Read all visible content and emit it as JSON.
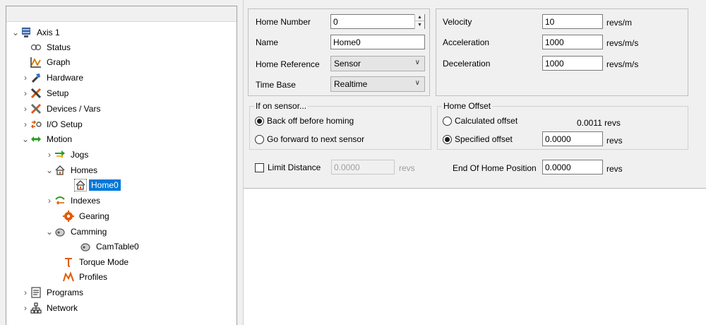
{
  "tree": {
    "items": [
      {
        "label": "Axis 1",
        "toggle": "expanded",
        "icon": "axis-icon"
      },
      {
        "label": "Status",
        "toggle": "none",
        "icon": "status-icon"
      },
      {
        "label": "Graph",
        "toggle": "none",
        "icon": "graph-icon"
      },
      {
        "label": "Hardware",
        "toggle": "collapsed",
        "icon": "hardware-icon"
      },
      {
        "label": "Setup",
        "toggle": "collapsed",
        "icon": "setup-icon"
      },
      {
        "label": "Devices / Vars",
        "toggle": "collapsed",
        "icon": "devices-icon"
      },
      {
        "label": "I/O Setup",
        "toggle": "collapsed",
        "icon": "io-setup-icon"
      },
      {
        "label": "Motion",
        "toggle": "expanded",
        "icon": "motion-icon"
      },
      {
        "label": "Jogs",
        "toggle": "collapsed",
        "icon": "jogs-icon"
      },
      {
        "label": "Homes",
        "toggle": "expanded",
        "icon": "home-icon"
      },
      {
        "label": "Home0",
        "toggle": "none",
        "icon": "home-icon",
        "selected": true
      },
      {
        "label": "Indexes",
        "toggle": "collapsed",
        "icon": "indexes-icon"
      },
      {
        "label": "Gearing",
        "toggle": "none",
        "icon": "gearing-icon"
      },
      {
        "label": "Camming",
        "toggle": "expanded",
        "icon": "camming-icon"
      },
      {
        "label": "CamTable0",
        "toggle": "none",
        "icon": "cam-table-icon"
      },
      {
        "label": "Torque Mode",
        "toggle": "none",
        "icon": "torque-icon"
      },
      {
        "label": "Profiles",
        "toggle": "none",
        "icon": "profiles-icon"
      },
      {
        "label": "Programs",
        "toggle": "collapsed",
        "icon": "programs-icon"
      },
      {
        "label": "Network",
        "toggle": "collapsed",
        "icon": "network-icon"
      }
    ]
  },
  "home": {
    "number_label": "Home Number",
    "number_value": "0",
    "name_label": "Name",
    "name_value": "Home0",
    "reference_label": "Home Reference",
    "reference_value": "Sensor",
    "timebase_label": "Time Base",
    "timebase_value": "Realtime"
  },
  "motion": {
    "velocity_label": "Velocity",
    "velocity_value": "10",
    "velocity_unit": "revs/m",
    "accel_label": "Acceleration",
    "accel_value": "1000",
    "accel_unit": "revs/m/s",
    "decel_label": "Deceleration",
    "decel_value": "1000",
    "decel_unit": "revs/m/s"
  },
  "sensor_group": {
    "title": "If on sensor...",
    "option1": "Back off before homing",
    "option1_selected": true,
    "option2": "Go forward to next sensor",
    "option2_selected": false
  },
  "offset_group": {
    "title": "Home Offset",
    "calculated_label": "Calculated offset",
    "calculated_value": "0.0011 revs",
    "specified_label": "Specified offset",
    "specified_value": "0.0000",
    "specified_unit": "revs",
    "selected": "specified"
  },
  "limit": {
    "label": "Limit Distance",
    "checked": false,
    "value": "0.0000",
    "unit": "revs"
  },
  "end_position": {
    "label": "End Of Home Position",
    "value": "0.0000",
    "unit": "revs"
  }
}
